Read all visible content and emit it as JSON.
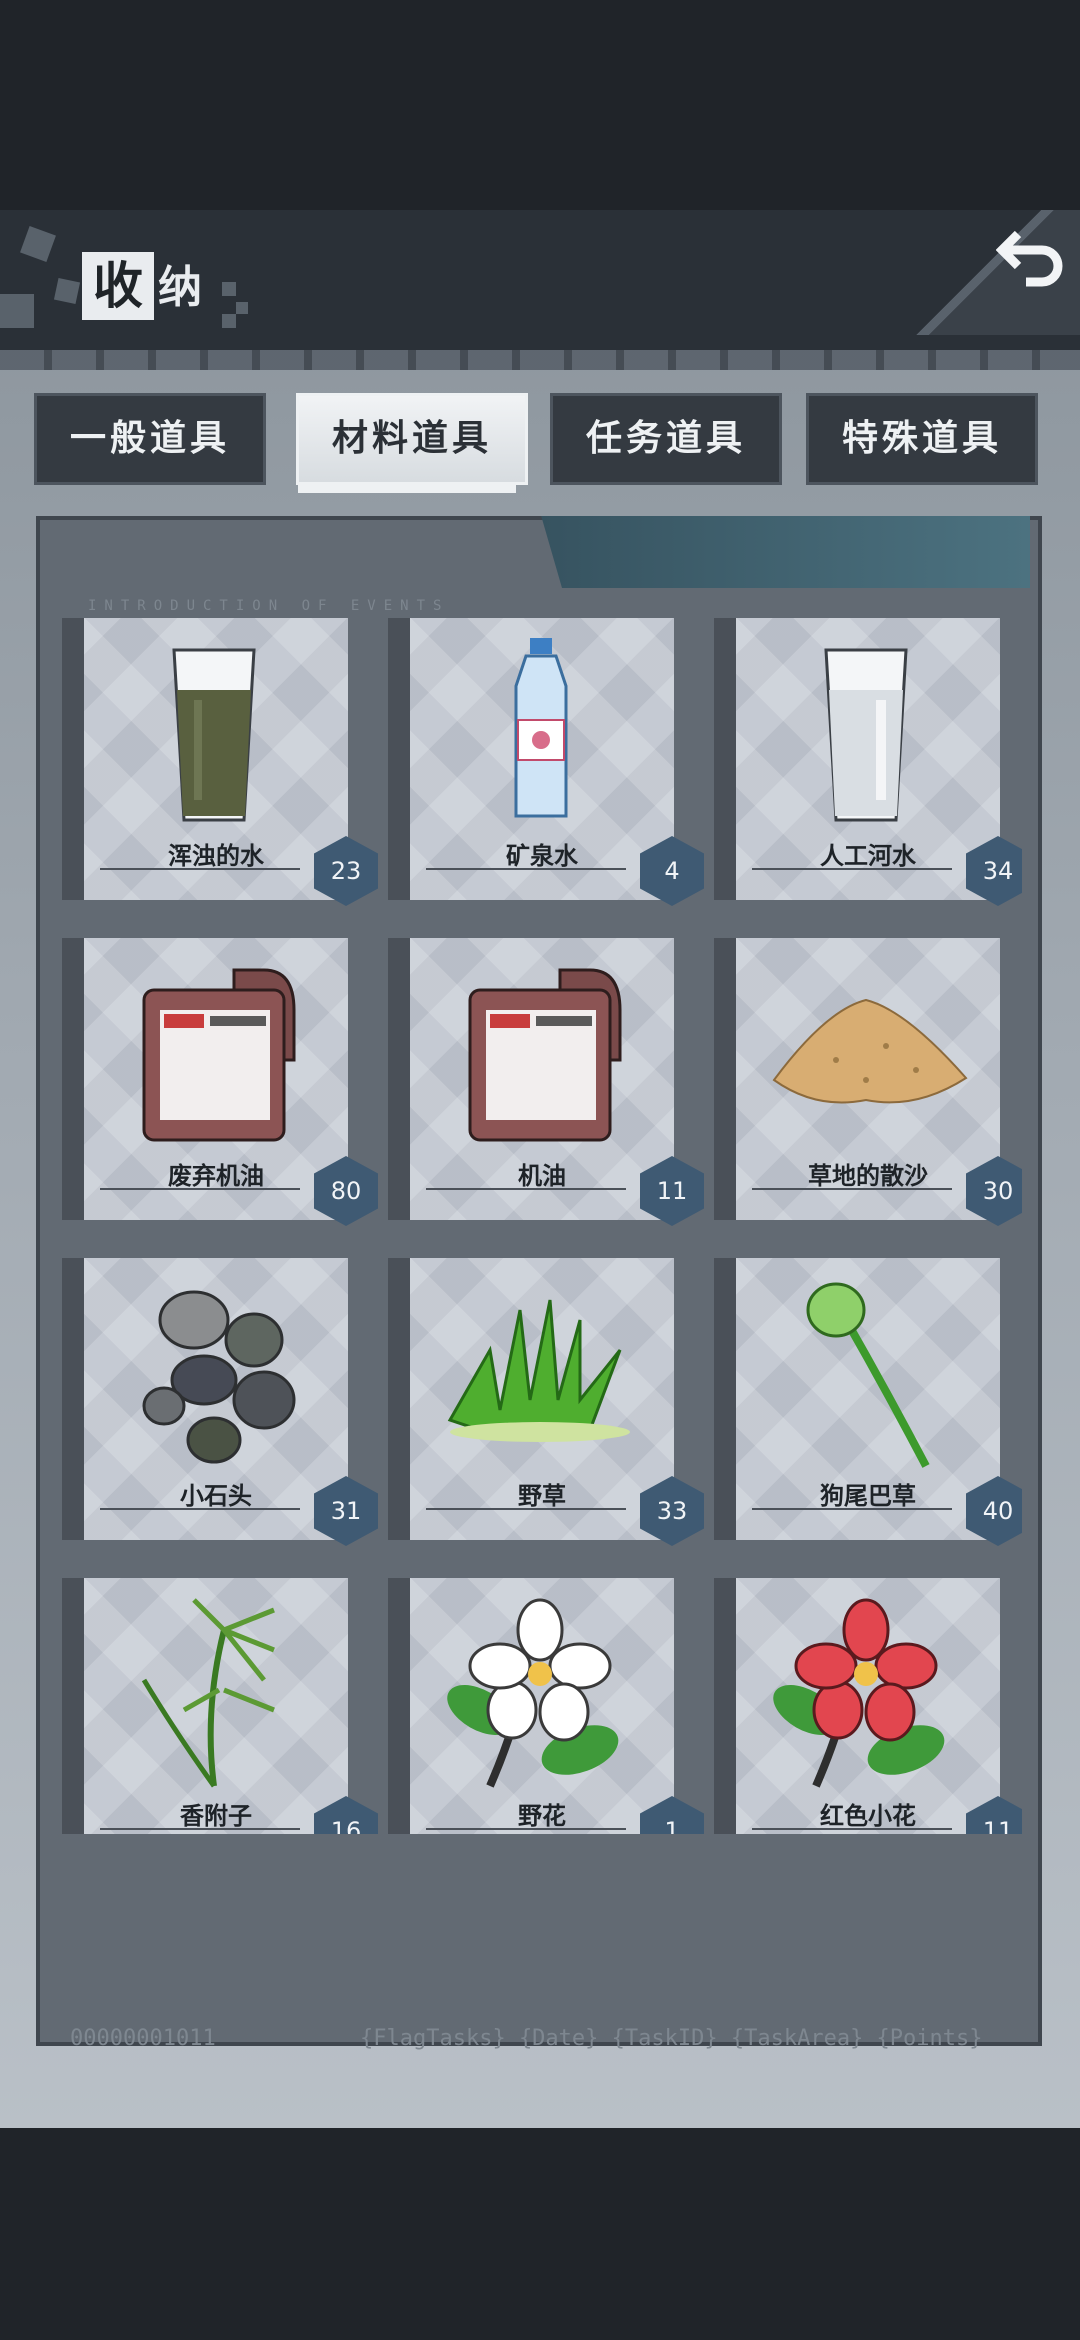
{
  "header": {
    "title_boxed": "收",
    "title_tail": "纳",
    "back_icon": "undo-arrow-icon"
  },
  "tabs": [
    {
      "label": "一般道具",
      "active": false
    },
    {
      "label": "材料道具",
      "active": true
    },
    {
      "label": "任务道具",
      "active": false
    },
    {
      "label": "特殊道具",
      "active": false
    }
  ],
  "panel": {
    "caption": "INTRODUCTION OF EVENTS",
    "footer_left": "00000001011",
    "footer_right": "{FlagTasks} {Date} {TaskID} {TaskArea} {Points}"
  },
  "items": [
    {
      "name": "浑浊的水",
      "count": "23",
      "icon": "murky-water-glass-icon"
    },
    {
      "name": "矿泉水",
      "count": "4",
      "icon": "water-bottle-icon"
    },
    {
      "name": "人工河水",
      "count": "34",
      "icon": "river-water-glass-icon"
    },
    {
      "name": "废弃机油",
      "count": "80",
      "icon": "oil-canister-icon"
    },
    {
      "name": "机油",
      "count": "11",
      "icon": "oil-canister-icon"
    },
    {
      "name": "草地的散沙",
      "count": "30",
      "icon": "sand-pile-icon"
    },
    {
      "name": "小石头",
      "count": "31",
      "icon": "pebbles-icon"
    },
    {
      "name": "野草",
      "count": "33",
      "icon": "grass-tuft-icon"
    },
    {
      "name": "狗尾巴草",
      "count": "40",
      "icon": "foxtail-grass-icon"
    },
    {
      "name": "香附子",
      "count": "16",
      "icon": "sedge-plant-icon"
    },
    {
      "name": "野花",
      "count": "1",
      "icon": "white-flower-icon"
    },
    {
      "name": "红色小花",
      "count": "11",
      "icon": "red-flower-icon"
    },
    {
      "name": "",
      "count": "",
      "icon": "blue-flower-icon"
    },
    {
      "name": "",
      "count": "",
      "icon": "soda-can-icon"
    },
    {
      "name": "",
      "count": "",
      "icon": "coconut-shell-icon"
    }
  ],
  "colors": {
    "accent": "#3f5a73",
    "panel": "#626a73",
    "header": "#2a3037"
  }
}
